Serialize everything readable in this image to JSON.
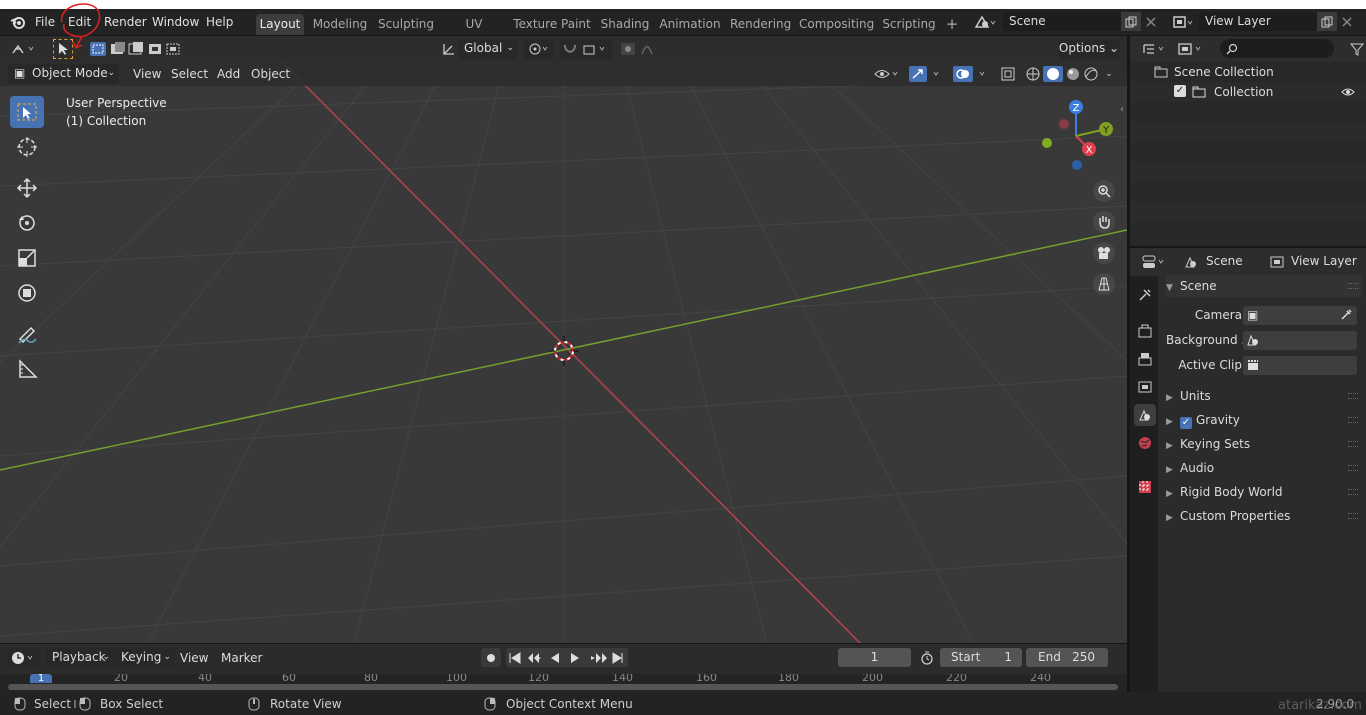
{
  "topbar": {
    "menus": [
      "File",
      "Edit",
      "Render",
      "Window",
      "Help"
    ],
    "workspaces": [
      "Layout",
      "Modeling",
      "Sculpting",
      "UV Editing",
      "Texture Paint",
      "Shading",
      "Animation",
      "Rendering",
      "Compositing",
      "Scripting"
    ],
    "active_workspace": "Layout",
    "add_workspace": "+",
    "scene_name": "Scene",
    "view_layer": "View Layer"
  },
  "tool_header": {
    "orientation": "Global",
    "options": "Options"
  },
  "viewport_header": {
    "mode": "Object Mode",
    "menus": [
      "View",
      "Select",
      "Add",
      "Object"
    ]
  },
  "viewport": {
    "perspective_label": "User Perspective",
    "collection_label": "(1) Collection",
    "gizmo_axes": {
      "z": "Z",
      "y": "Y",
      "x": "X"
    }
  },
  "outliner": {
    "search_placeholder": "",
    "root": "Scene Collection",
    "items": [
      "Collection"
    ]
  },
  "properties": {
    "header_scene": "Scene",
    "header_view_layer": "View Layer",
    "panel_title": "Scene",
    "fields": {
      "camera_label": "Camera",
      "background_label": "Background ...",
      "active_clip_label": "Active Clip"
    },
    "subpanels": [
      "Units",
      "Gravity",
      "Keying Sets",
      "Audio",
      "Rigid Body World",
      "Custom Properties"
    ],
    "gravity_checked": true
  },
  "timeline": {
    "menus": [
      "Playback",
      "Keying",
      "View",
      "Marker"
    ],
    "current_frame": "1",
    "start_label": "Start",
    "start_value": "1",
    "end_label": "End",
    "end_value": "250",
    "ruler_current": "1",
    "ruler_ticks": [
      "20",
      "40",
      "60",
      "80",
      "100",
      "120",
      "140",
      "160",
      "180",
      "200",
      "220",
      "240"
    ]
  },
  "statusbar": {
    "select": "Select",
    "box_select": "Box Select",
    "rotate_view": "Rotate View",
    "context_menu": "Object Context Menu",
    "version": "2.90.0",
    "watermark": "atarikaz.com"
  },
  "colors": {
    "accent": "#4772b3",
    "x_axis": "#c1414e",
    "y_axis": "#6d9a2b",
    "annotation": "#e02020"
  }
}
